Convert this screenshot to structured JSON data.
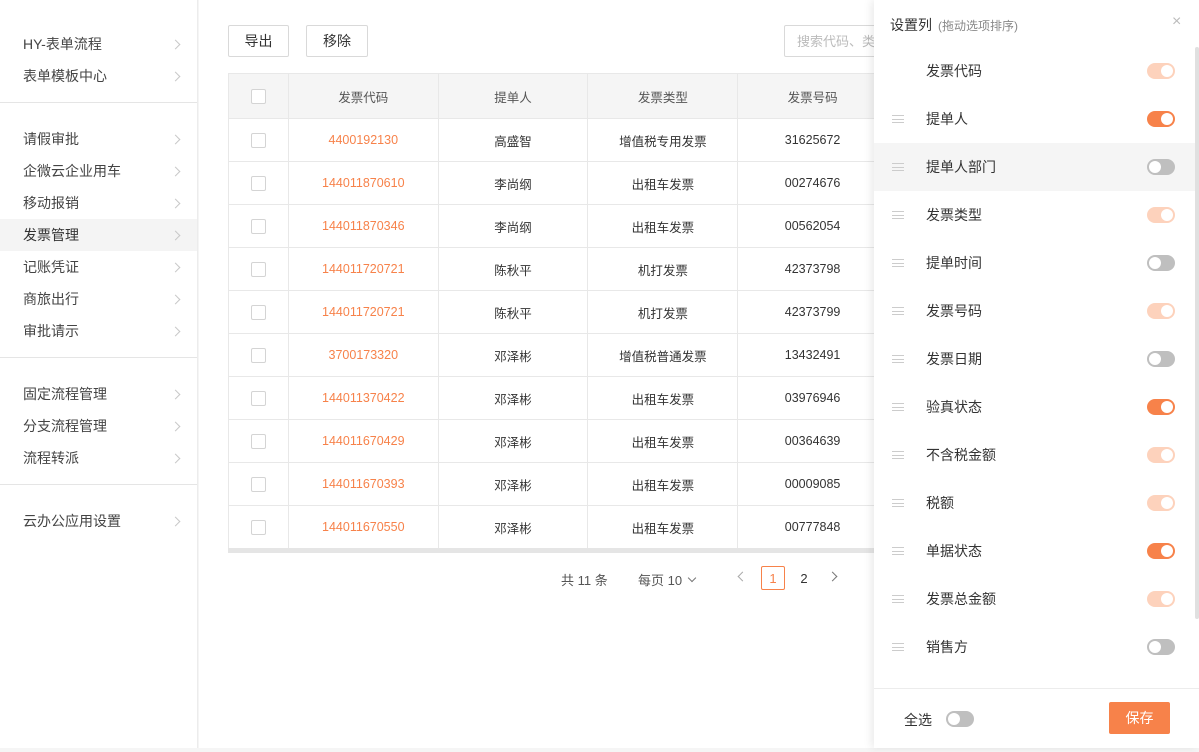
{
  "sidebar": {
    "groups": [
      [
        "HY-表单流程",
        "表单模板中心"
      ],
      [
        "请假审批",
        "企微云企业用车",
        "移动报销",
        "发票管理",
        "记账凭证",
        "商旅出行",
        "审批请示"
      ],
      [
        "固定流程管理",
        "分支流程管理",
        "流程转派"
      ],
      [
        "云办公应用设置"
      ]
    ],
    "active": "发票管理"
  },
  "toolbar": {
    "export_label": "导出",
    "remove_label": "移除",
    "search_placeholder": "搜索代码、类型"
  },
  "table": {
    "columns": [
      "发票代码",
      "提单人",
      "发票类型",
      "发票号码"
    ],
    "rows": [
      [
        "4400192130",
        "高盛智",
        "增值税专用发票",
        "31625672"
      ],
      [
        "144011870610",
        "李尚纲",
        "出租车发票",
        "00274676"
      ],
      [
        "144011870346",
        "李尚纲",
        "出租车发票",
        "00562054"
      ],
      [
        "144011720721",
        "陈秋平",
        "机打发票",
        "42373798"
      ],
      [
        "144011720721",
        "陈秋平",
        "机打发票",
        "42373799"
      ],
      [
        "3700173320",
        "邓泽彬",
        "增值税普通发票",
        "13432491"
      ],
      [
        "144011370422",
        "邓泽彬",
        "出租车发票",
        "03976946"
      ],
      [
        "144011670429",
        "邓泽彬",
        "出租车发票",
        "00364639"
      ],
      [
        "144011670393",
        "邓泽彬",
        "出租车发票",
        "00009085"
      ],
      [
        "144011670550",
        "邓泽彬",
        "出租车发票",
        "00777848"
      ]
    ]
  },
  "pagination": {
    "total_text": "共 11 条",
    "page_size_text": "每页 10",
    "pages": [
      "1",
      "2"
    ],
    "current": "1"
  },
  "drawer": {
    "title": "设置列",
    "hint": "(拖动选项排序)",
    "close_icon": "×",
    "columns": [
      {
        "label": "发票代码",
        "state": "disabled",
        "draggable": false
      },
      {
        "label": "提单人",
        "state": "on",
        "draggable": true
      },
      {
        "label": "提单人部门",
        "state": "off",
        "draggable": true,
        "hover": true
      },
      {
        "label": "发票类型",
        "state": "disabled",
        "draggable": true
      },
      {
        "label": "提单时间",
        "state": "off",
        "draggable": true
      },
      {
        "label": "发票号码",
        "state": "disabled",
        "draggable": true
      },
      {
        "label": "发票日期",
        "state": "off",
        "draggable": true
      },
      {
        "label": "验真状态",
        "state": "on",
        "draggable": true
      },
      {
        "label": "不含税金额",
        "state": "disabled",
        "draggable": true
      },
      {
        "label": "税额",
        "state": "disabled",
        "draggable": true
      },
      {
        "label": "单据状态",
        "state": "on",
        "draggable": true
      },
      {
        "label": "发票总金额",
        "state": "disabled",
        "draggable": true
      },
      {
        "label": "销售方",
        "state": "off",
        "draggable": true
      }
    ],
    "select_all_label": "全选",
    "select_all_state": "off",
    "save_label": "保存"
  },
  "colors": {
    "accent": "#f7824a",
    "accent_disabled": "#fdd2bc",
    "toggle_off": "#bfbfbf"
  }
}
